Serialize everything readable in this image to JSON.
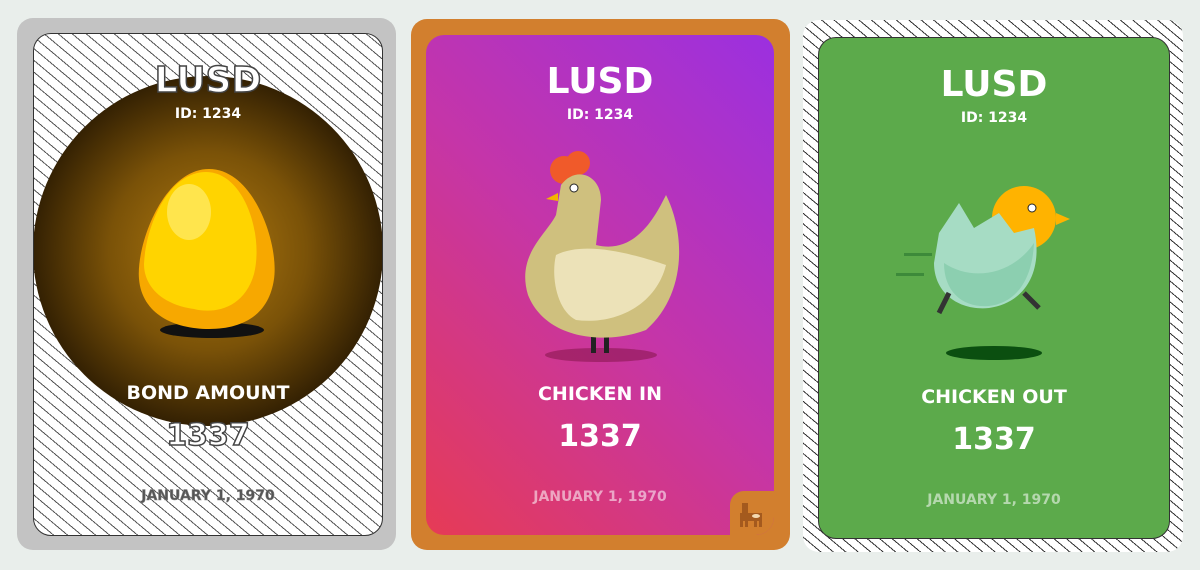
{
  "cards": [
    {
      "title": "LUSD",
      "id": "ID: 1234",
      "label": "BOND AMOUNT",
      "amount": "1337",
      "date": "JANUARY 1, 1970",
      "image": "golden-egg",
      "frame_color": "#c3c3c3"
    },
    {
      "title": "LUSD",
      "id": "ID: 1234",
      "label": "CHICKEN IN",
      "amount": "1337",
      "date": "JANUARY 1, 1970",
      "image": "chicken",
      "frame_color": "#d27f2e",
      "badge": "llama-icon"
    },
    {
      "title": "LUSD",
      "id": "ID: 1234",
      "label": "CHICKEN OUT",
      "amount": "1337",
      "date": "JANUARY 1, 1970",
      "image": "chick-in-eggshell",
      "frame_color": "#5caa4b"
    }
  ]
}
